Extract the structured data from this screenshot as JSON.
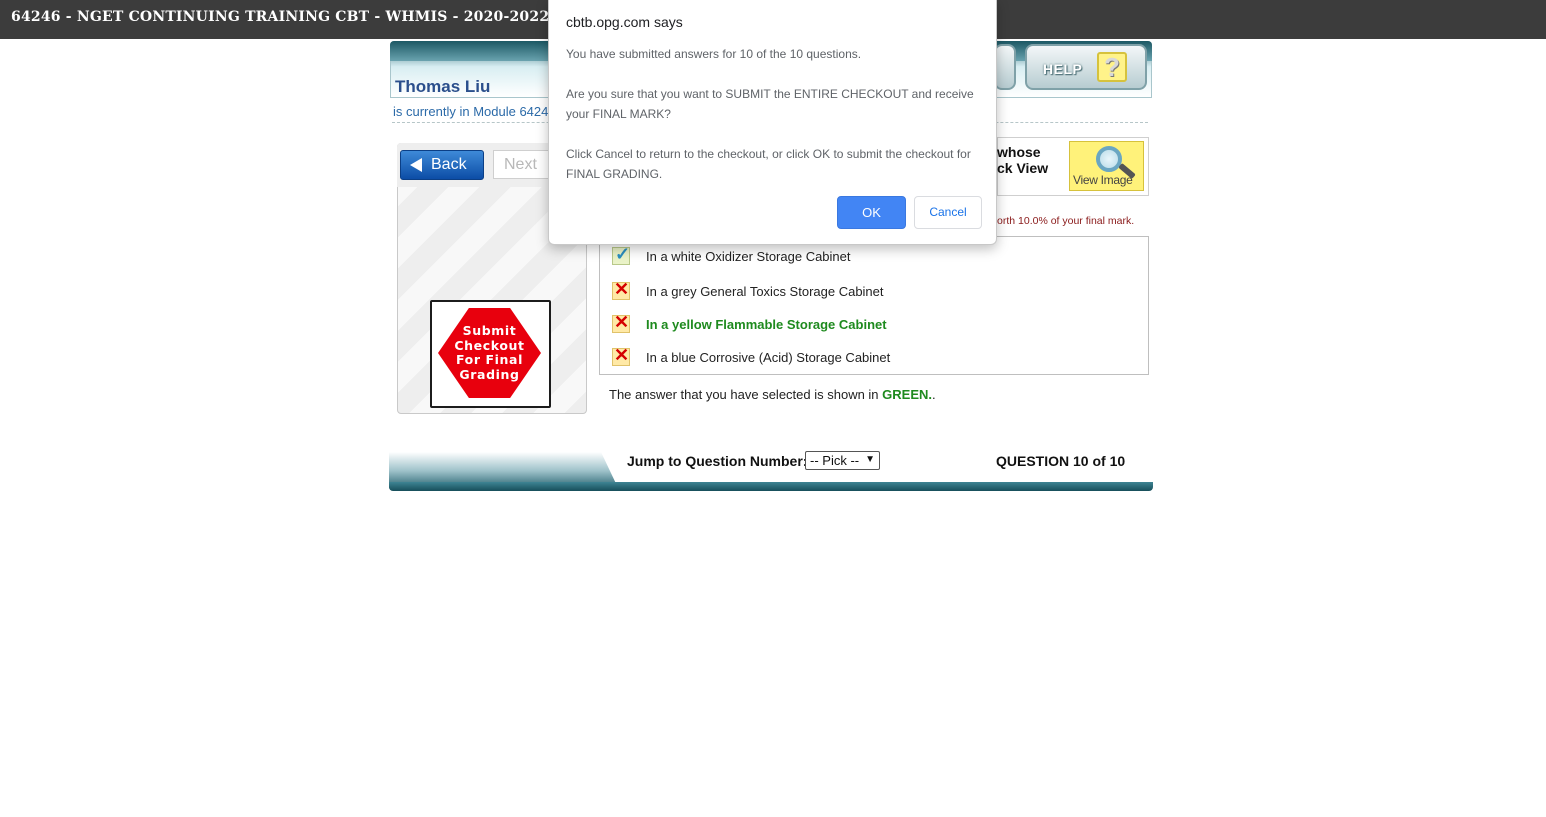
{
  "window": {
    "title": "64246 - NGET CONTINUING TRAINING CBT - WHMIS - 2020-2022"
  },
  "header": {
    "help_label": "HELP",
    "help_icon_glyph": "?"
  },
  "user": {
    "name": "Thomas Liu",
    "module_line": "is currently in Module 64246"
  },
  "nav": {
    "back_label": "Back",
    "next_label": "Next"
  },
  "submit": {
    "label": "Submit Checkout For Final Grading"
  },
  "question": {
    "view_text_partial": "whose\nck View",
    "view_image_label": "View Image",
    "worth_text_partial": "orth 10.0% of your final mark.",
    "answers": [
      {
        "text": "In a white Oxidizer Storage Cabinet",
        "icon": "checkmark-icon",
        "selected": false
      },
      {
        "text": "In a grey General Toxics Storage Cabinet",
        "icon": "x-mark-icon",
        "selected": false
      },
      {
        "text": "In a yellow Flammable Storage Cabinet",
        "icon": "x-mark-icon",
        "selected": true
      },
      {
        "text": "In a blue Corrosive (Acid) Storage Cabinet",
        "icon": "x-mark-icon",
        "selected": false
      }
    ],
    "note_prefix": "The answer that you have selected is shown in ",
    "note_highlight": "GREEN.",
    "note_suffix": "."
  },
  "footer": {
    "jump_label": "Jump to Question Number:",
    "pick_value": "-- Pick --",
    "counter": "QUESTION 10 of 10"
  },
  "dialog": {
    "title": "cbtb.opg.com says",
    "message": "You have submitted answers for 10 of the 10 questions.\n\nAre you sure that you want to SUBMIT the ENTIRE CHECKOUT and receive your FINAL MARK?\n\nClick Cancel to return to the checkout, or click OK to submit the checkout for FINAL GRADING.",
    "ok_label": "OK",
    "cancel_label": "Cancel"
  },
  "colors": {
    "selected_answer": "#1e8a1e",
    "dialog_ok": "#4285f4",
    "submit_stop": "#e8000d",
    "topbar": "#3c3c3c"
  }
}
